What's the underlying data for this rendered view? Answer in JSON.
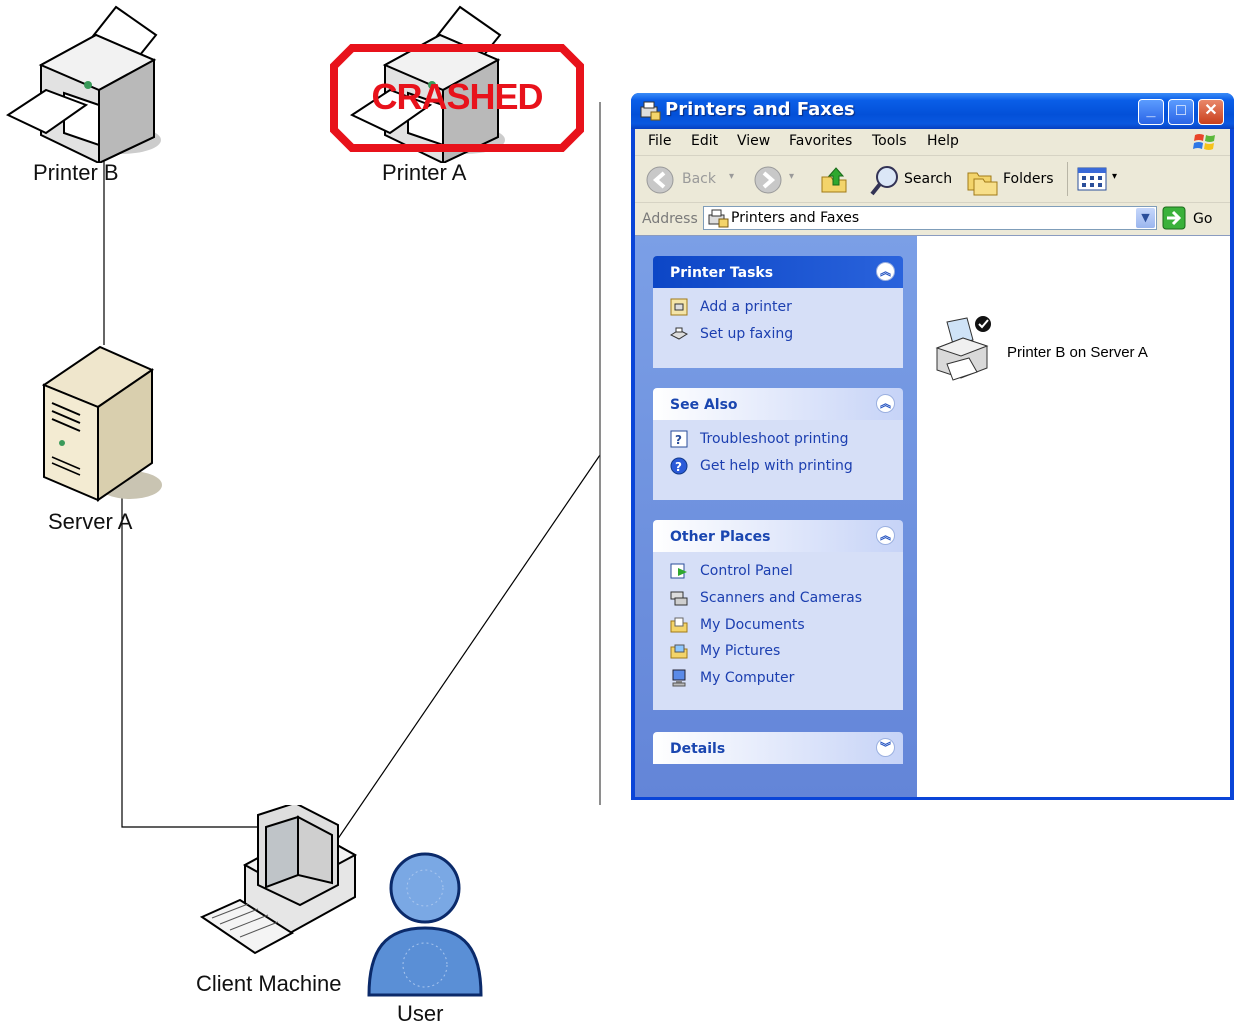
{
  "diagram": {
    "printer_b_label": "Printer B",
    "printer_a_label": "Printer A",
    "crashed_label": "CRASHED",
    "server_label": "Server A",
    "client_label": "Client Machine",
    "user_label": "User"
  },
  "window": {
    "title": "Printers and Faxes",
    "menu": [
      "File",
      "Edit",
      "View",
      "Favorites",
      "Tools",
      "Help"
    ],
    "toolbar": {
      "back_label": "Back",
      "search_label": "Search",
      "folders_label": "Folders"
    },
    "address": {
      "label": "Address",
      "value": "Printers and Faxes",
      "go_label": "Go"
    },
    "panels": {
      "printer_tasks": {
        "title": "Printer Tasks",
        "items": [
          "Add a printer",
          "Set up faxing"
        ]
      },
      "see_also": {
        "title": "See Also",
        "items": [
          "Troubleshoot printing",
          "Get help with printing"
        ]
      },
      "other_places": {
        "title": "Other Places",
        "items": [
          "Control Panel",
          "Scanners and Cameras",
          "My Documents",
          "My Pictures",
          "My Computer"
        ]
      },
      "details": {
        "title": "Details"
      }
    },
    "printer_item": {
      "label": "Printer B on Server A",
      "icon": "printer-default-icon"
    }
  },
  "colors": {
    "crashed_red": "#e8121b",
    "xp_blue": "#0a45d8",
    "link_blue": "#1c3fb0",
    "user_blue": "#5a8fd6"
  }
}
